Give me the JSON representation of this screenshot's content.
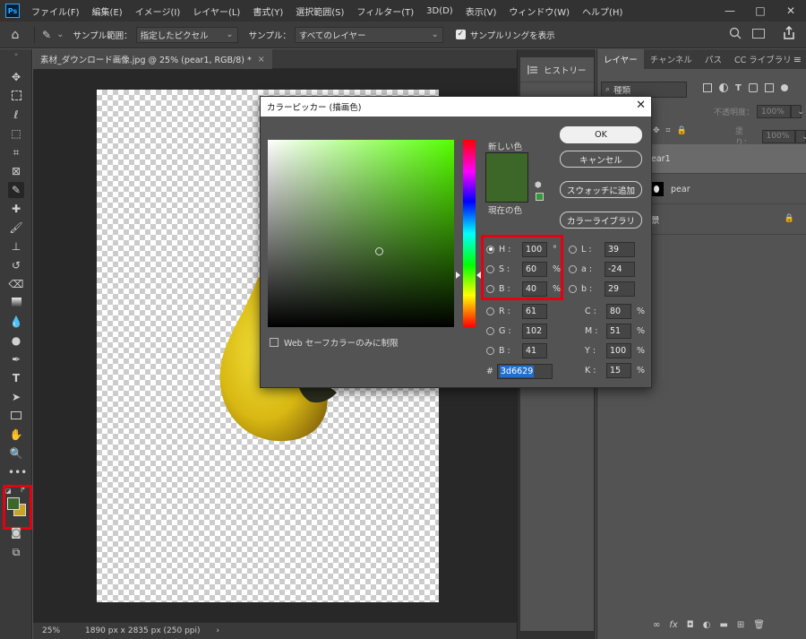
{
  "app": {
    "logo": "Ps",
    "menu": [
      "ファイル(F)",
      "編集(E)",
      "イメージ(I)",
      "レイヤー(L)",
      "書式(Y)",
      "選択範囲(S)",
      "フィルター(T)",
      "3D(D)",
      "表示(V)",
      "ウィンドウ(W)",
      "ヘルプ(H)"
    ],
    "window_controls": [
      "—",
      "□",
      "✕"
    ]
  },
  "options": {
    "home_icon": "⌂",
    "tool_icon": "✎",
    "sample_size_label": "サンプル範囲：",
    "sample_size_value": "指定したピクセル",
    "sample_label": "サンプル：",
    "sample_value": "すべてのレイヤー",
    "show_ring_check": "✓",
    "show_ring_label": "サンプルリングを表示"
  },
  "document": {
    "tab_title": "素材_ダウンロード画像.jpg @ 25% (pear1, RGB/8) *",
    "tab_close": "×",
    "zoom": "25%",
    "info": "1890 px x 2835 px (250 ppi)",
    "status_arrow": "›"
  },
  "tools": {
    "foreground_color": "#3d6629",
    "background_color": "#c9a227"
  },
  "history": {
    "tab_label": "ヒストリー"
  },
  "layers": {
    "tabs": [
      "レイヤー",
      "チャンネル",
      "パス",
      "CC ライブラリ"
    ],
    "search_placeholder": "種類",
    "opacity_label": "不透明度：",
    "opacity_value": "100%",
    "fill_label": "塗り：",
    "fill_value": "100%",
    "rows": [
      {
        "name": "ear1"
      },
      {
        "name": "pear"
      },
      {
        "name": "景"
      }
    ]
  },
  "dialog": {
    "title": "カラーピッカー (描画色)",
    "close": "✕",
    "new_color_label": "新しい色",
    "current_color_label": "現在の色",
    "new_color": "#3d6629",
    "current_color": "#3d6629",
    "web_safe_label": "Web セーフカラーのみに制限",
    "buttons": {
      "ok": "OK",
      "cancel": "キャンセル",
      "add_swatch": "スウォッチに追加",
      "color_library": "カラーライブラリ"
    },
    "hsb": [
      {
        "label": "H :",
        "value": "100",
        "unit": "°",
        "selected": true
      },
      {
        "label": "S :",
        "value": "60",
        "unit": "%",
        "selected": false
      },
      {
        "label": "B :",
        "value": "40",
        "unit": "%",
        "selected": false
      }
    ],
    "rgb": [
      {
        "label": "R :",
        "value": "61"
      },
      {
        "label": "G :",
        "value": "102"
      },
      {
        "label": "B :",
        "value": "41"
      }
    ],
    "lab": [
      {
        "label": "L :",
        "value": "39"
      },
      {
        "label": "a :",
        "value": "-24"
      },
      {
        "label": "b :",
        "value": "29"
      }
    ],
    "cmyk": [
      {
        "label": "C :",
        "value": "80",
        "unit": "%"
      },
      {
        "label": "M :",
        "value": "51",
        "unit": "%"
      },
      {
        "label": "Y :",
        "value": "100",
        "unit": "%"
      },
      {
        "label": "K :",
        "value": "15",
        "unit": "%"
      }
    ],
    "hex_label": "#",
    "hex_value": "3d6629"
  },
  "highlight_color": "#e60012"
}
